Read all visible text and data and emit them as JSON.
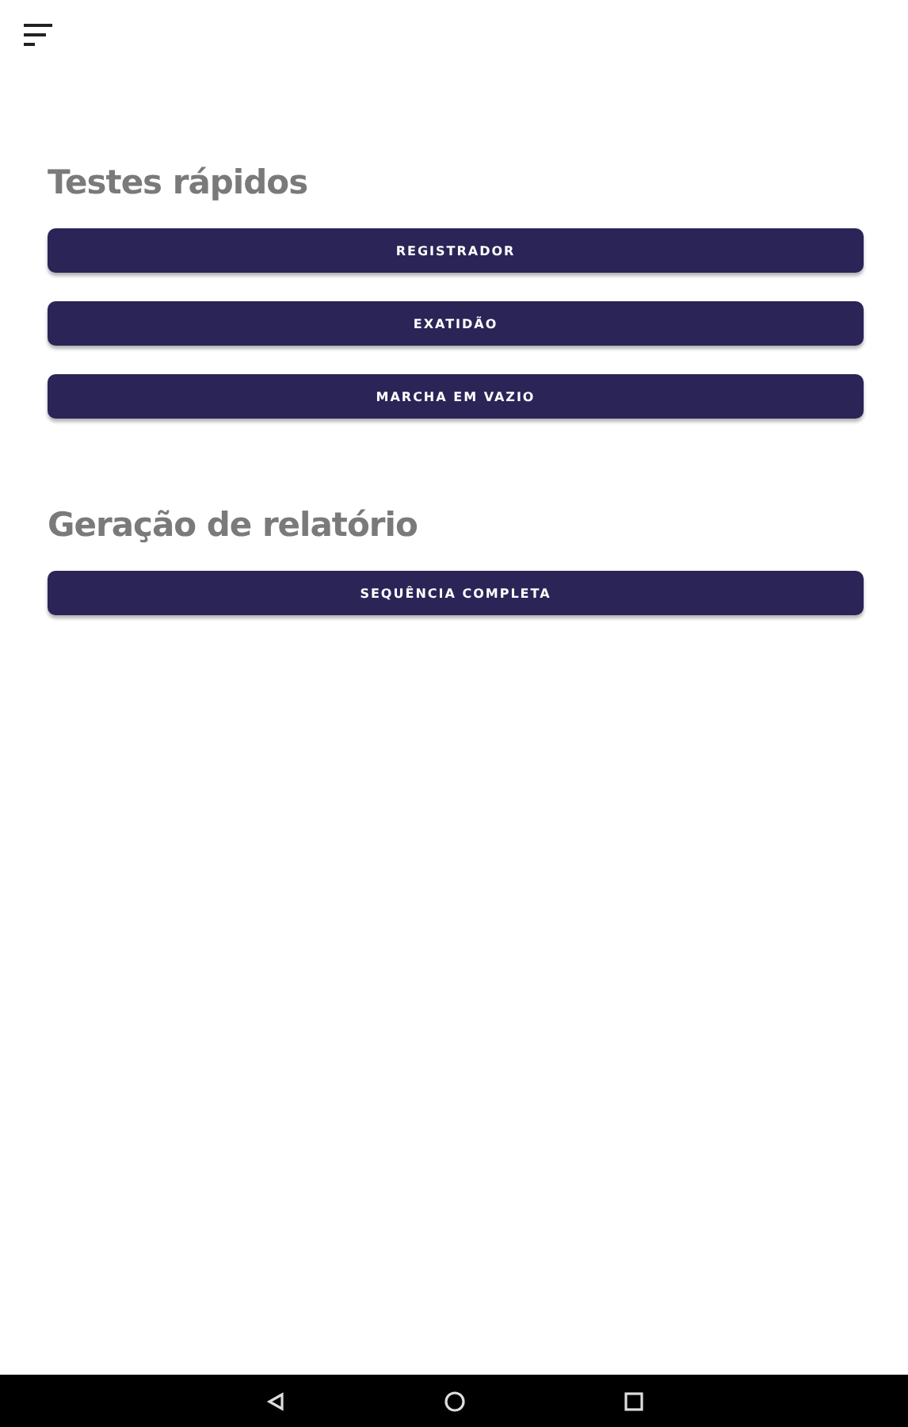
{
  "sections": [
    {
      "title": "Testes rápidos",
      "buttons": [
        "REGISTRADOR",
        "EXATIDÃO",
        "MARCHA EM VAZIO"
      ]
    },
    {
      "title": "Geração de relatório",
      "buttons": [
        "SEQUÊNCIA COMPLETA"
      ]
    }
  ]
}
